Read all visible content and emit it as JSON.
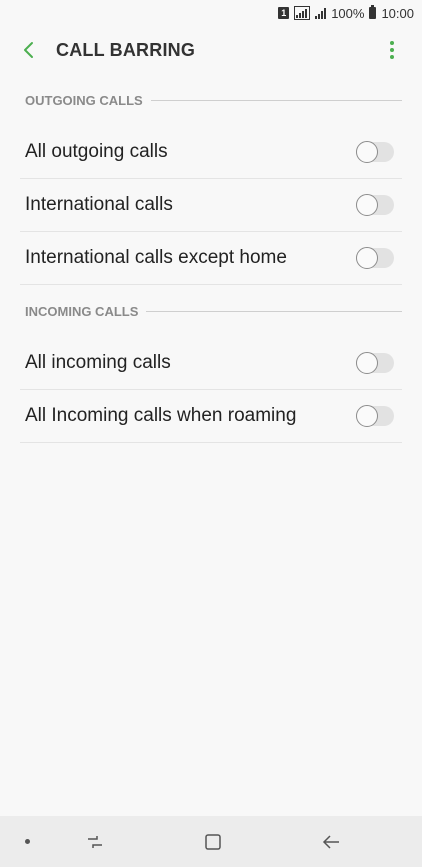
{
  "status_bar": {
    "sim_slot": "1",
    "battery_percent": "100%",
    "time": "10:00"
  },
  "app_bar": {
    "title": "CALL BARRING",
    "back_icon": "chevron-left-icon",
    "menu_icon": "more-vertical-icon"
  },
  "sections": [
    {
      "header": "OUTGOING CALLS",
      "items": [
        {
          "label": "All outgoing calls",
          "enabled": false
        },
        {
          "label": "International calls",
          "enabled": false
        },
        {
          "label": "International calls except home",
          "enabled": false
        }
      ]
    },
    {
      "header": "INCOMING CALLS",
      "items": [
        {
          "label": "All incoming calls",
          "enabled": false
        },
        {
          "label": "All Incoming calls when roaming",
          "enabled": false
        }
      ]
    }
  ],
  "nav_bar": {
    "recents_icon": "recent-apps-icon",
    "home_icon": "home-icon",
    "back_icon": "back-arrow-icon"
  },
  "colors": {
    "accent": "#4caf50",
    "background": "#f8f8f8",
    "section_header": "#8a8a8a",
    "toggle_track": "#e2e2e2"
  }
}
